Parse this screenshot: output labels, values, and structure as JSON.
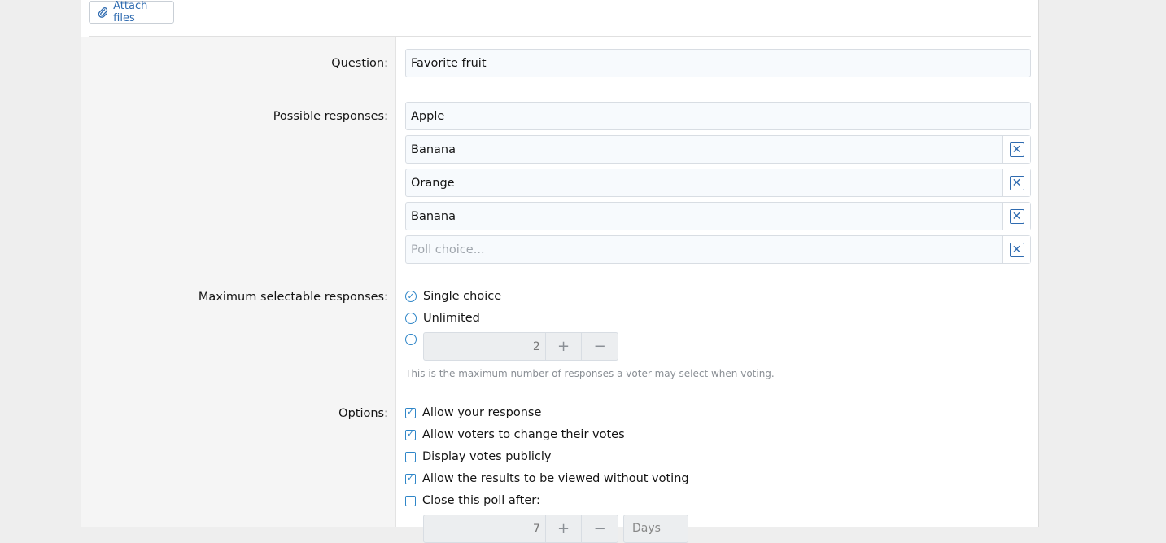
{
  "attach": {
    "label": "Attach files"
  },
  "poll": {
    "question_label": "Question:",
    "question_value": "Favorite fruit",
    "responses_label": "Possible responses:",
    "responses": [
      "Apple",
      "Banana",
      "Orange",
      "Banana"
    ],
    "response_placeholder": "Poll choice...",
    "max_label": "Maximum selectable responses:",
    "max_options": [
      "Single choice",
      "Unlimited"
    ],
    "max_value": "2",
    "max_hint": "This is the maximum number of responses a voter may select when voting.",
    "options_label": "Options:",
    "options": [
      {
        "label": "Allow your response",
        "checked": true
      },
      {
        "label": "Allow voters to change their votes",
        "checked": true
      },
      {
        "label": "Display votes publicly",
        "checked": false
      },
      {
        "label": "Allow the results to be viewed without voting",
        "checked": true
      },
      {
        "label": "Close this poll after:",
        "checked": false
      }
    ],
    "close_value": "7",
    "close_unit": "Days"
  },
  "colors": {
    "accent": "#2f86c8",
    "link": "#2f6bb0"
  }
}
